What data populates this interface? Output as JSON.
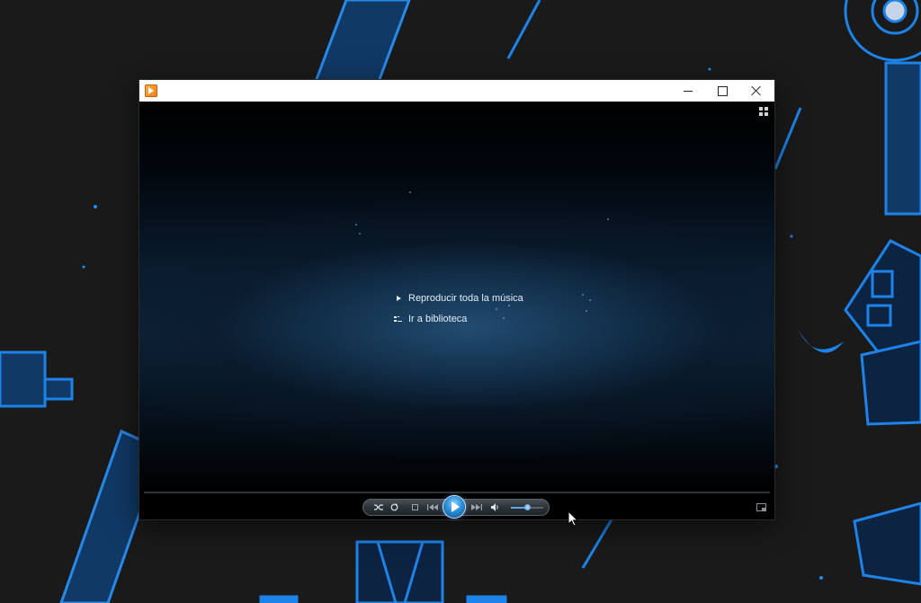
{
  "window": {
    "app_icon": "media-player-icon",
    "buttons": {
      "minimize": "minimize-icon",
      "maximize": "maximize-icon",
      "close": "close-icon"
    }
  },
  "viewport": {
    "switch_to_library_icon": "switch-to-library-icon",
    "menu": [
      {
        "label": "Reproducir toda la música",
        "icon": "play-icon"
      },
      {
        "label": "Ir a biblioteca",
        "icon": "library-icon"
      }
    ]
  },
  "controls": {
    "shuffle_icon": "shuffle-icon",
    "repeat_icon": "repeat-icon",
    "stop_icon": "stop-icon",
    "previous_icon": "previous-icon",
    "play_icon": "play-icon",
    "next_icon": "next-icon",
    "mute_icon": "speaker-icon",
    "volume": 0.5,
    "fullscreen_icon": "fullscreen-icon"
  },
  "colors": {
    "accent": "#1e88e5",
    "wallpaper_line": "#1f8fff",
    "viewport_glow": "#224e73"
  }
}
